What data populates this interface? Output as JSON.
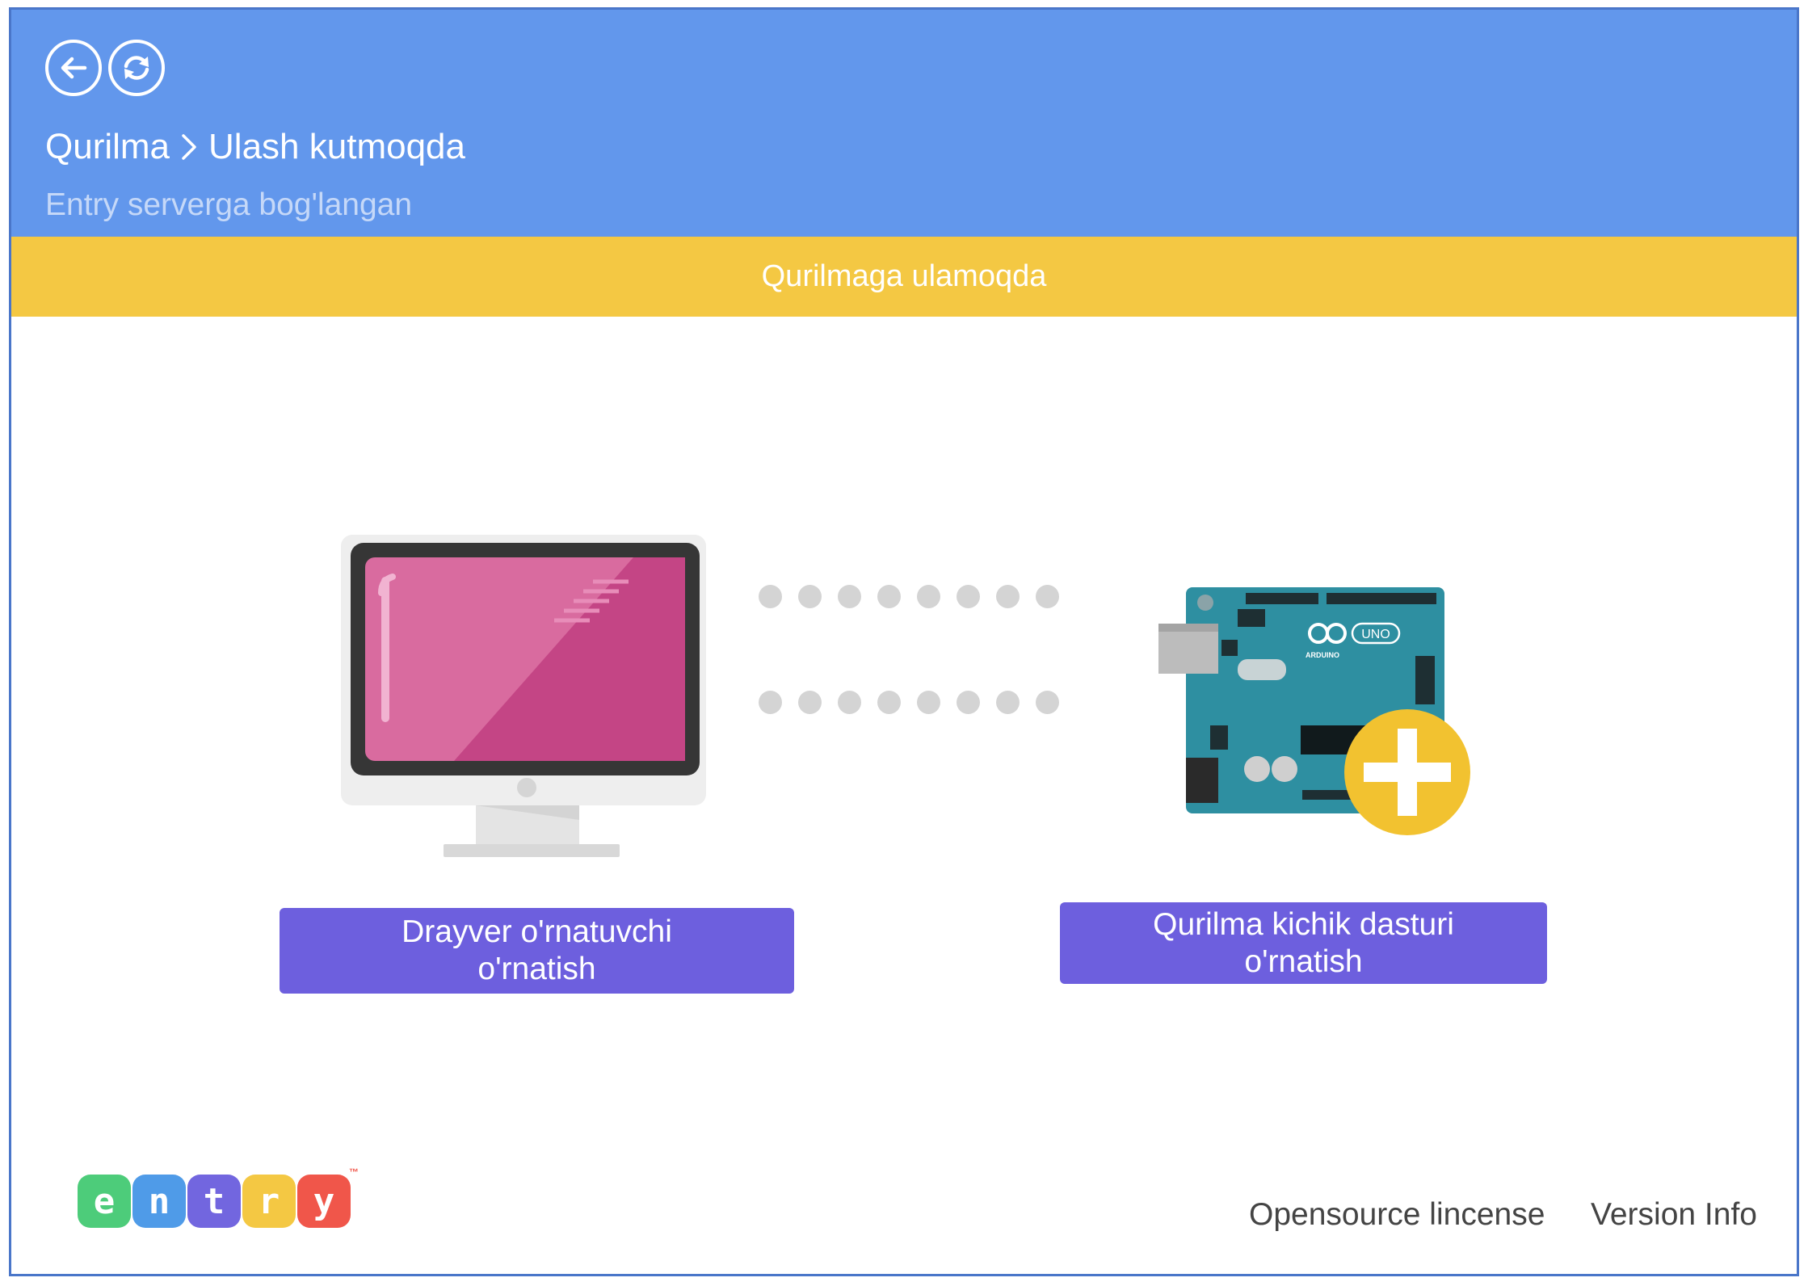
{
  "header": {
    "breadcrumb": {
      "parent": "Qurilma",
      "current": "Ulash kutmoqda"
    },
    "subtitle": "Entry serverga bog'langan",
    "back_icon": "arrow-left-icon",
    "refresh_icon": "refresh-icon",
    "color": "#6297ec"
  },
  "status": {
    "text": "Qurilmaga ulamoqda",
    "color": "#f4c843"
  },
  "actions": {
    "driver": {
      "line1": "Drayver o'rnatuvchi",
      "line2": "o'rnatish"
    },
    "firmware": {
      "line1": "Qurilma kichik dasturi",
      "line2": "o'rnatish"
    },
    "color": "#6d5fde"
  },
  "illustration": {
    "computer_icon": "monitor-icon",
    "device_icon": "arduino-uno-board-icon",
    "add_icon": "plus-badge-icon",
    "board_labels": {
      "brand": "ARDUINO",
      "model": "UNO"
    }
  },
  "logo": {
    "letters": [
      "e",
      "n",
      "t",
      "r",
      "y"
    ],
    "colors": [
      "#4dcc7a",
      "#4f9be8",
      "#7266df",
      "#f4c843",
      "#f0564a"
    ],
    "mark": "™"
  },
  "footer": {
    "license": "Opensource lincense",
    "version": "Version Info"
  }
}
